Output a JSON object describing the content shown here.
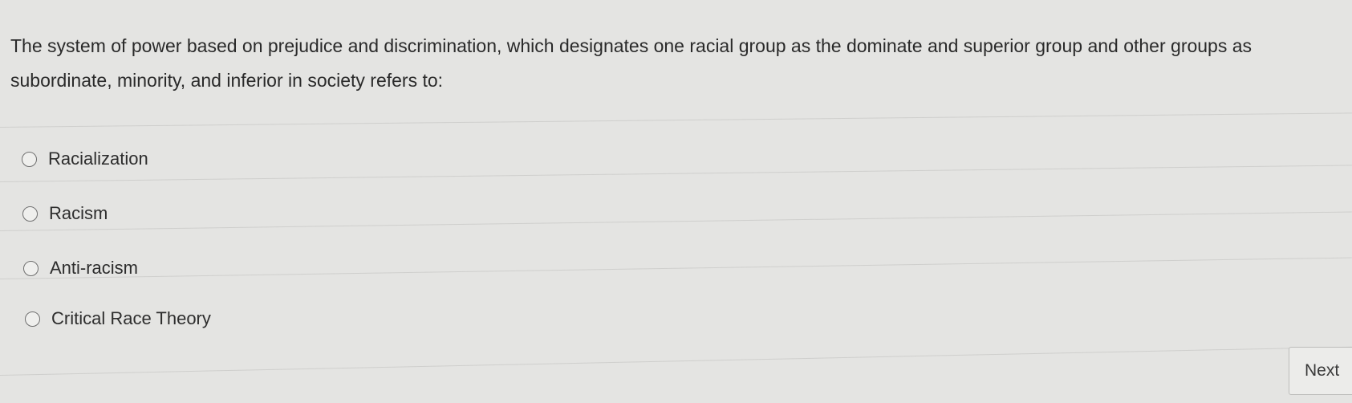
{
  "question": {
    "text": "The system of power based on prejudice and discrimination, which designates one racial group as the dominate and superior group and other groups as subordinate, minority, and inferior in society refers to:"
  },
  "options": [
    {
      "label": "Racialization"
    },
    {
      "label": "Racism"
    },
    {
      "label": "Anti-racism"
    },
    {
      "label": "Critical Race Theory"
    }
  ],
  "navigation": {
    "next_label": "Next"
  }
}
